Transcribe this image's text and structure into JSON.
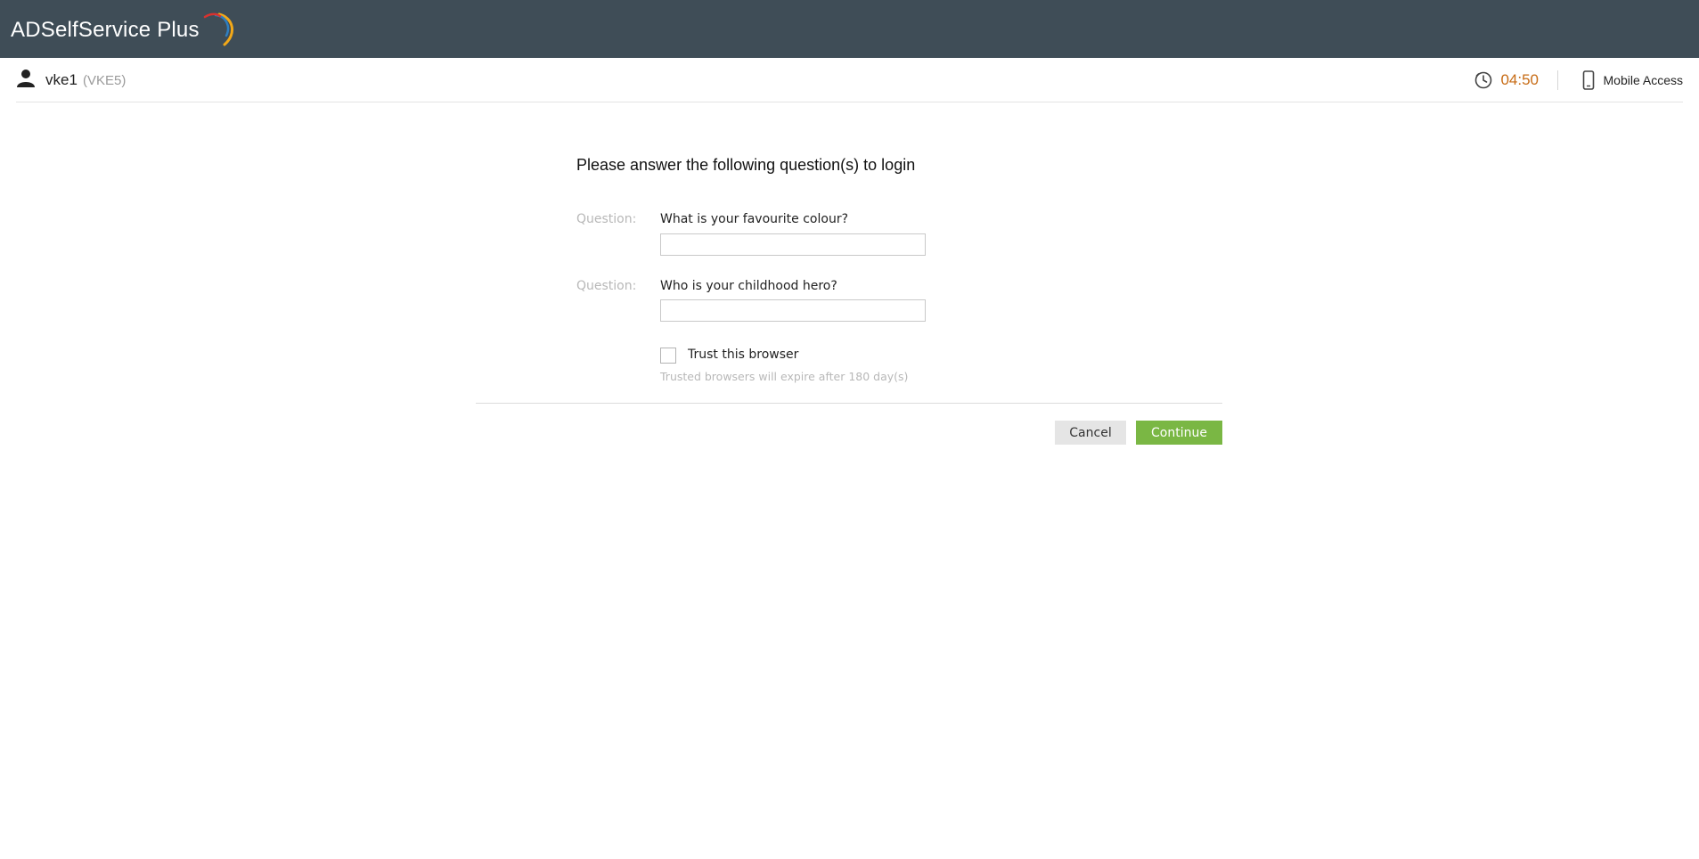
{
  "app": {
    "logo_text": "ADSelfService Plus",
    "header_bg": "#3f4d57"
  },
  "user": {
    "name": "vke1",
    "domain": "(VKE5)",
    "icon": "user-icon"
  },
  "session": {
    "timer": "04:50",
    "timer_color": "#c76b14",
    "mobile_access_label": "Mobile Access"
  },
  "form": {
    "title": "Please answer the following question(s) to login",
    "questions": [
      {
        "label": "Question:",
        "text": "What is your favourite colour?",
        "value": ""
      },
      {
        "label": "Question:",
        "text": "Who is your childhood hero?",
        "value": ""
      }
    ],
    "trust_browser": {
      "label": "Trust this browser",
      "checked": false,
      "note": "Trusted browsers will expire after 180 day(s)"
    },
    "buttons": {
      "cancel": "Cancel",
      "continue": "Continue",
      "continue_color": "#7ab744"
    }
  }
}
